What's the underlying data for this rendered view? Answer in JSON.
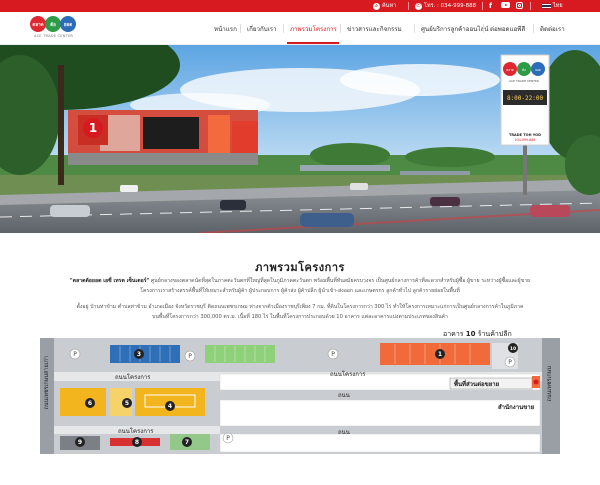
{
  "topbar": {
    "search_label": "ค้นหา",
    "phone_label": "โทร. : 034-999-888",
    "language": "ไทย",
    "icons": [
      "search-icon",
      "phone-icon",
      "facebook-icon",
      "youtube-icon",
      "instagram-icon",
      "thai-flag-icon"
    ]
  },
  "brand": {
    "logo_words": [
      "ตลาด",
      "ต้อ",
      "ยอด"
    ],
    "logo_colors": [
      "#e0262f",
      "#2e9c47",
      "#2d6cb6"
    ],
    "logo_sub": "ACE TRADE CENTER"
  },
  "nav": {
    "items": [
      {
        "label": "หน้าแรก"
      },
      {
        "label": "เกี่ยวกับเรา"
      },
      {
        "label": "ภาพรวมโครงการ"
      },
      {
        "label": "ข่าวสารและกิจกรรม"
      },
      {
        "label": "ศูนย์บริการลูกค้าออนไลน์"
      },
      {
        "label": "ต่อพอดแอพีสี"
      },
      {
        "label": "ติดต่อเรา"
      }
    ],
    "active_index": 2
  },
  "hero": {
    "billboard_logo": [
      "ตลาด",
      "ต้อ",
      "ยอด"
    ],
    "billboard_sub": "ACE TRADE CENTER",
    "billboard_time": "8:00-22:00",
    "billboard_bottom": "TRADE TOH YOD",
    "billboard_phone": "034-999-888",
    "building_number": "1"
  },
  "content": {
    "title": "ภาพรวมโครงการ",
    "para1_bold": "\"ตลาดต้อยอด เอซี่ เทรด เซ็นเตอร์\"",
    "para1_line1": " ศูนย์กลางของตลาดนัดที่สุดในภาคตะวันตกที่ใหญ่ที่สุดในภูมิภาคตะวันตก พร้อมพื้นที่ทันสมัยครบวงจร เป็นศูนย์กลางการค้าที่สะดวกสำหรับผู้ซื้อ ผู้ขาย ระหว่างผู้ซื้อและผู้ขาย",
    "para1_line2": "โครงการเราสร้างสรรค์พื้นที่ให้เหมาะสำหรับผู้ค้า ผู้ประกอบการ ผู้ค้าส่ง ผู้ค้าปลีก ผู้นำเข้า-ส่งออก และเกษตรกร ลูกค้าทั่วไป ลูกค้ารายย่อยในพื้นที่",
    "para2_line1": "ตั้งอยู่ บ้านท่าข้าม ตำบลท่าข้าม อำเภอเมือง จังหวัดราชบุรี ติดถนนเพชรเกษม ห่างจากตัวเมืองราชบุรีเพียง 7 กม. ที่ดินในโครงการกว่า 300 ไร่ ทำให้โครงการเหมาะแก่การเป็นศูนย์กลางการค้าในภูมิภาค",
    "para2_line2": "บนพื้นที่โครงการกว่า 300,000 ตร.ม. เนื้อที่ 180 ไร่ ในพื้นที่โครงการประกอบด้วย 10 อาคาร แต่ละอาคารแบ่งตามประเภทของสินค้า"
  },
  "plan": {
    "header_label": "อาคาร",
    "header_number": "10",
    "header_suffix": "ร้านค้าปลีก",
    "road_top": "ถนนโครงการ",
    "road_mid": "ถนนโครงการ",
    "road_lower": "ถนน",
    "road_main": "ถนน",
    "road_bottom": "ถนนโครงการ",
    "road_left": "ถนนเพชรเกษมสายเก่า",
    "road_right": "ถนนเพชรเกษม",
    "area_label": "พื้นที่ส่วนต่อขยาย",
    "office_label": "สำนักงานขาย",
    "parking_symbol": "P",
    "buildings": [
      "1",
      "3",
      "4",
      "5",
      "6",
      "7",
      "8",
      "9",
      "10"
    ]
  }
}
